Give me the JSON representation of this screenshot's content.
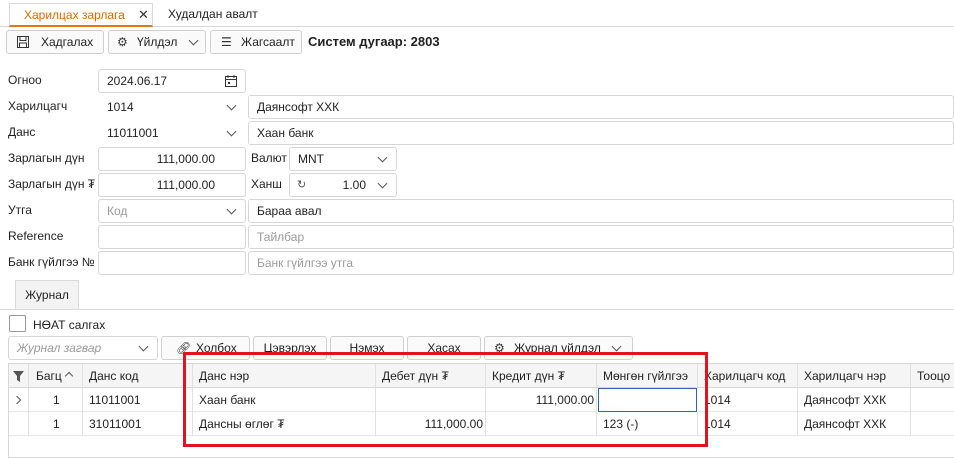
{
  "tabs": {
    "active_label": "Харилцах зарлага",
    "close_glyph": "✕",
    "other_label": "Худалдан авалт"
  },
  "toolbar": {
    "save_label": "Хадгалах",
    "actions_label": "Үйлдэл",
    "list_label": "Жагсаалт",
    "system_number": "Систем дугаар: 2803"
  },
  "form": {
    "date_label": "Огноо",
    "date_value": "2024.06.17",
    "partner_label": "Харилцагч",
    "partner_code": "1014",
    "partner_name": "Даянсофт ХХК",
    "account_label": "Данс",
    "account_code": "11011001",
    "account_name": "Хаан банк",
    "amount_label": "Зарлагын дүн",
    "amount_value": "111,000.00",
    "currency_label": "Валют",
    "currency_value": "MNT",
    "amount_mnt_label": "Зарлагын дүн ₮",
    "amount_mnt_value": "111,000.00",
    "rate_label": "Ханш",
    "rate_value": "1.00",
    "purpose_label": "Утга",
    "purpose_code_placeholder": "Код",
    "purpose_value": "Бараа авал",
    "reference_label": "Reference",
    "reference_value": "",
    "description_placeholder": "Тайлбар",
    "bank_tx_label": "Банк гүйлгээ №",
    "bank_tx_value": "",
    "bank_tx_desc_placeholder": "Банк гүйлгээ утга"
  },
  "journal": {
    "tab_label": "Журнал",
    "vat_label": "НӨАТ салгах",
    "template_placeholder": "Журнал загвар",
    "link_label": "Холбох",
    "clear_label": "Цэвэрлэх",
    "add_label": "Нэмэх",
    "delete_label": "Хасах",
    "actions_label": "Журнал үйлдэл",
    "columns": [
      "Багц",
      "Данс код",
      "Данс нэр",
      "Дебет дүн ₮",
      "Кредит дүн ₮",
      "Мөнгөн гүйлгээ",
      "Харилцагч код",
      "Харилцагч нэр",
      "Тооцо"
    ],
    "rows": [
      {
        "batch": "1",
        "account_code": "11011001",
        "account_name": "Хаан банк",
        "debit": "",
        "credit": "111,000.00",
        "cash_flow": "",
        "partner_code": "1014",
        "partner_name": "Даянсофт ХХК"
      },
      {
        "batch": "1",
        "account_code": "31011001",
        "account_name": "Дансны өглөг ₮",
        "debit": "111,000.00",
        "credit": "",
        "cash_flow": "123 (-)",
        "partner_code": "1014",
        "partner_name": "Даянсофт ХХК"
      }
    ]
  },
  "colors": {
    "accent": "#e07a10",
    "highlight": "#e0141e",
    "selection": "#2b63b8"
  }
}
